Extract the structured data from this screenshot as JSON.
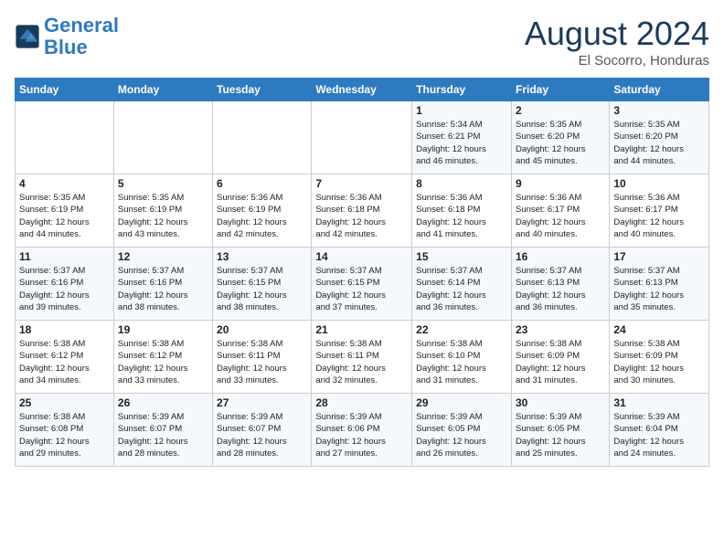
{
  "header": {
    "logo_line1": "General",
    "logo_line2": "Blue",
    "month_title": "August 2024",
    "subtitle": "El Socorro, Honduras"
  },
  "days_of_week": [
    "Sunday",
    "Monday",
    "Tuesday",
    "Wednesday",
    "Thursday",
    "Friday",
    "Saturday"
  ],
  "weeks": [
    [
      {
        "day": "",
        "info": ""
      },
      {
        "day": "",
        "info": ""
      },
      {
        "day": "",
        "info": ""
      },
      {
        "day": "",
        "info": ""
      },
      {
        "day": "1",
        "info": "Sunrise: 5:34 AM\nSunset: 6:21 PM\nDaylight: 12 hours\nand 46 minutes."
      },
      {
        "day": "2",
        "info": "Sunrise: 5:35 AM\nSunset: 6:20 PM\nDaylight: 12 hours\nand 45 minutes."
      },
      {
        "day": "3",
        "info": "Sunrise: 5:35 AM\nSunset: 6:20 PM\nDaylight: 12 hours\nand 44 minutes."
      }
    ],
    [
      {
        "day": "4",
        "info": "Sunrise: 5:35 AM\nSunset: 6:19 PM\nDaylight: 12 hours\nand 44 minutes."
      },
      {
        "day": "5",
        "info": "Sunrise: 5:35 AM\nSunset: 6:19 PM\nDaylight: 12 hours\nand 43 minutes."
      },
      {
        "day": "6",
        "info": "Sunrise: 5:36 AM\nSunset: 6:19 PM\nDaylight: 12 hours\nand 42 minutes."
      },
      {
        "day": "7",
        "info": "Sunrise: 5:36 AM\nSunset: 6:18 PM\nDaylight: 12 hours\nand 42 minutes."
      },
      {
        "day": "8",
        "info": "Sunrise: 5:36 AM\nSunset: 6:18 PM\nDaylight: 12 hours\nand 41 minutes."
      },
      {
        "day": "9",
        "info": "Sunrise: 5:36 AM\nSunset: 6:17 PM\nDaylight: 12 hours\nand 40 minutes."
      },
      {
        "day": "10",
        "info": "Sunrise: 5:36 AM\nSunset: 6:17 PM\nDaylight: 12 hours\nand 40 minutes."
      }
    ],
    [
      {
        "day": "11",
        "info": "Sunrise: 5:37 AM\nSunset: 6:16 PM\nDaylight: 12 hours\nand 39 minutes."
      },
      {
        "day": "12",
        "info": "Sunrise: 5:37 AM\nSunset: 6:16 PM\nDaylight: 12 hours\nand 38 minutes."
      },
      {
        "day": "13",
        "info": "Sunrise: 5:37 AM\nSunset: 6:15 PM\nDaylight: 12 hours\nand 38 minutes."
      },
      {
        "day": "14",
        "info": "Sunrise: 5:37 AM\nSunset: 6:15 PM\nDaylight: 12 hours\nand 37 minutes."
      },
      {
        "day": "15",
        "info": "Sunrise: 5:37 AM\nSunset: 6:14 PM\nDaylight: 12 hours\nand 36 minutes."
      },
      {
        "day": "16",
        "info": "Sunrise: 5:37 AM\nSunset: 6:13 PM\nDaylight: 12 hours\nand 36 minutes."
      },
      {
        "day": "17",
        "info": "Sunrise: 5:37 AM\nSunset: 6:13 PM\nDaylight: 12 hours\nand 35 minutes."
      }
    ],
    [
      {
        "day": "18",
        "info": "Sunrise: 5:38 AM\nSunset: 6:12 PM\nDaylight: 12 hours\nand 34 minutes."
      },
      {
        "day": "19",
        "info": "Sunrise: 5:38 AM\nSunset: 6:12 PM\nDaylight: 12 hours\nand 33 minutes."
      },
      {
        "day": "20",
        "info": "Sunrise: 5:38 AM\nSunset: 6:11 PM\nDaylight: 12 hours\nand 33 minutes."
      },
      {
        "day": "21",
        "info": "Sunrise: 5:38 AM\nSunset: 6:11 PM\nDaylight: 12 hours\nand 32 minutes."
      },
      {
        "day": "22",
        "info": "Sunrise: 5:38 AM\nSunset: 6:10 PM\nDaylight: 12 hours\nand 31 minutes."
      },
      {
        "day": "23",
        "info": "Sunrise: 5:38 AM\nSunset: 6:09 PM\nDaylight: 12 hours\nand 31 minutes."
      },
      {
        "day": "24",
        "info": "Sunrise: 5:38 AM\nSunset: 6:09 PM\nDaylight: 12 hours\nand 30 minutes."
      }
    ],
    [
      {
        "day": "25",
        "info": "Sunrise: 5:38 AM\nSunset: 6:08 PM\nDaylight: 12 hours\nand 29 minutes."
      },
      {
        "day": "26",
        "info": "Sunrise: 5:39 AM\nSunset: 6:07 PM\nDaylight: 12 hours\nand 28 minutes."
      },
      {
        "day": "27",
        "info": "Sunrise: 5:39 AM\nSunset: 6:07 PM\nDaylight: 12 hours\nand 28 minutes."
      },
      {
        "day": "28",
        "info": "Sunrise: 5:39 AM\nSunset: 6:06 PM\nDaylight: 12 hours\nand 27 minutes."
      },
      {
        "day": "29",
        "info": "Sunrise: 5:39 AM\nSunset: 6:05 PM\nDaylight: 12 hours\nand 26 minutes."
      },
      {
        "day": "30",
        "info": "Sunrise: 5:39 AM\nSunset: 6:05 PM\nDaylight: 12 hours\nand 25 minutes."
      },
      {
        "day": "31",
        "info": "Sunrise: 5:39 AM\nSunset: 6:04 PM\nDaylight: 12 hours\nand 24 minutes."
      }
    ]
  ]
}
